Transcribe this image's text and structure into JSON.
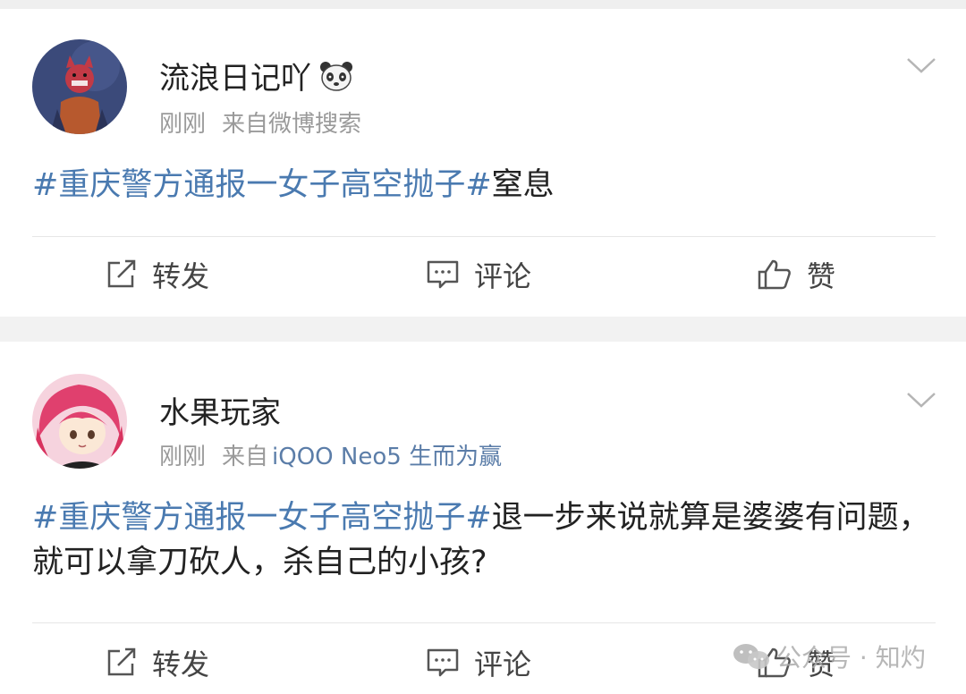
{
  "posts": [
    {
      "username": "流浪日记吖",
      "badge_icon": "panda-icon",
      "time": "刚刚",
      "source_prefix": "来自微博搜索",
      "source_device": "",
      "hashtag": "#重庆警方通报一女子高空抛子#",
      "text": "窒息",
      "actions": {
        "repost": "转发",
        "comment": "评论",
        "like": "赞"
      }
    },
    {
      "username": "水果玩家",
      "badge_icon": "",
      "time": "刚刚",
      "source_prefix": "来自",
      "source_device": "iQOO Neo5 生而为赢",
      "hashtag": "#重庆警方通报一女子高空抛子#",
      "text": "退一步来说就算是婆婆有问题，就可以拿刀砍人，杀自己的小孩?",
      "actions": {
        "repost": "转发",
        "comment": "评论",
        "like": "赞"
      }
    }
  ],
  "watermark": "公众号 · 知灼",
  "colors": {
    "hashtag": "#4a7ab0",
    "source_link": "#5b7da8",
    "meta": "#9a9a9a"
  }
}
